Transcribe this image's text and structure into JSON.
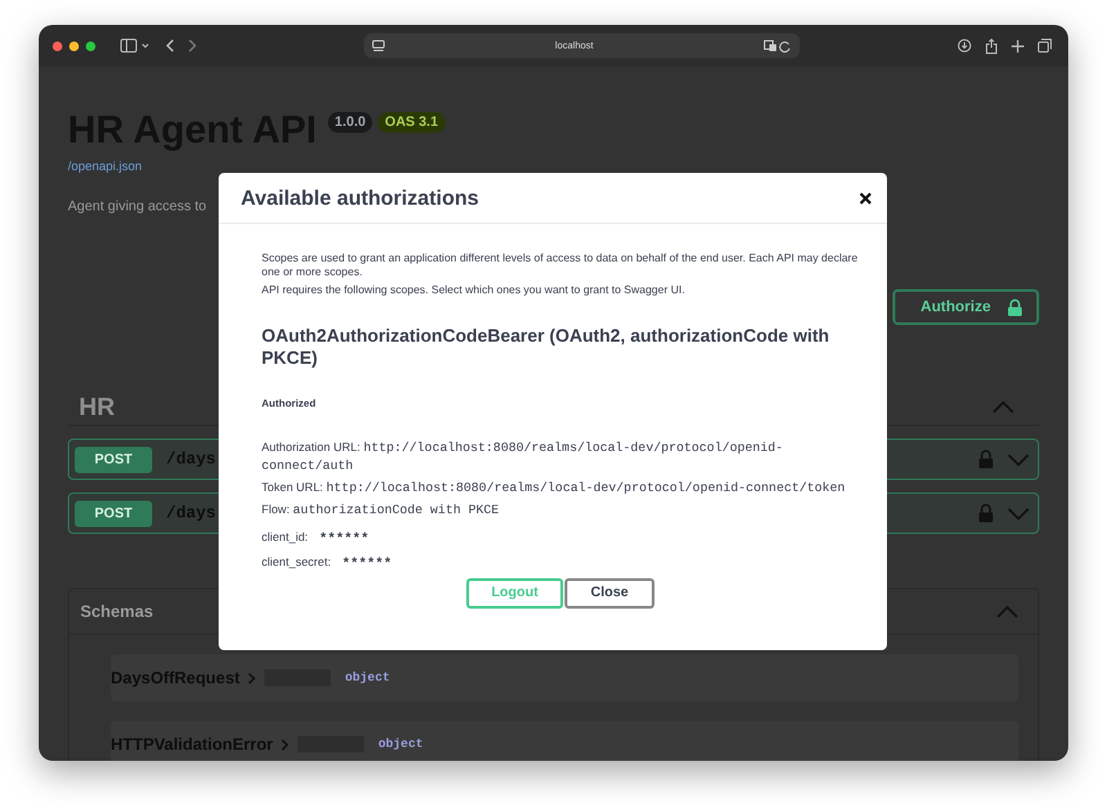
{
  "browser": {
    "url": "localhost"
  },
  "page": {
    "title": "HR Agent API",
    "version": "1.0.0",
    "oas": "OAS 3.1",
    "spec_link": "/openapi.json",
    "description": "Agent giving access to",
    "authorize_button": "Authorize",
    "tag": {
      "name": "HR",
      "expanded": true,
      "operations": [
        {
          "method": "POST",
          "path": "/days",
          "locked": true
        },
        {
          "method": "POST",
          "path": "/days",
          "locked": true
        }
      ]
    },
    "schemas": {
      "title": "Schemas",
      "expanded": true,
      "items": [
        {
          "name": "DaysOffRequest",
          "type": "object"
        },
        {
          "name": "HTTPValidationError",
          "type": "object"
        }
      ]
    }
  },
  "modal": {
    "title": "Available authorizations",
    "notes": [
      "Scopes are used to grant an application different levels of access to data on behalf of the end user. Each API may declare one or more scopes.",
      "API requires the following scopes. Select which ones you want to grant to Swagger UI."
    ],
    "scheme_title": "OAuth2AuthorizationCodeBearer (OAuth2, authorizationCode with PKCE)",
    "status": "Authorized",
    "fields": [
      {
        "label": "Authorization URL:",
        "value": "http://localhost:8080/realms/local-dev/protocol/openid-connect/auth"
      },
      {
        "label": "Token URL:",
        "value": "http://localhost:8080/realms/local-dev/protocol/openid-connect/token"
      },
      {
        "label": "Flow:",
        "value": "authorizationCode with PKCE"
      }
    ],
    "credentials": [
      {
        "label": "client_id:",
        "value": "******"
      },
      {
        "label": "client_secret:",
        "value": "******"
      }
    ],
    "buttons": [
      {
        "label": "Logout",
        "kind": "primary"
      },
      {
        "label": "Close",
        "kind": "secondary"
      }
    ]
  }
}
